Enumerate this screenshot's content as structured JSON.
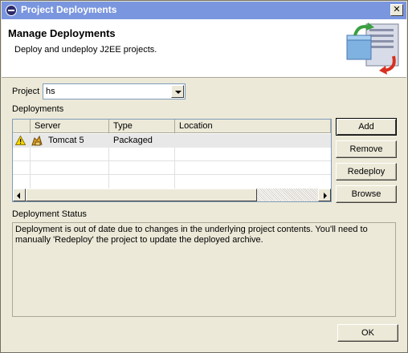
{
  "window": {
    "title": "Project Deployments",
    "close_label": "✕"
  },
  "banner": {
    "title": "Manage Deployments",
    "description": "Deploy and undeploy J2EE projects."
  },
  "project": {
    "label": "Project",
    "selected": "hs"
  },
  "deployments": {
    "label": "Deployments",
    "columns": [
      "",
      "Server",
      "Type",
      "Location"
    ],
    "rows": [
      {
        "status": "warning",
        "server": "Tomcat 5",
        "type": "Packaged",
        "location": ""
      }
    ]
  },
  "buttons": {
    "add": "Add",
    "remove": "Remove",
    "redeploy": "Redeploy",
    "browse": "Browse",
    "ok": "OK"
  },
  "status": {
    "label": "Deployment Status",
    "text": "Deployment is out of date due to changes in the underlying project contents. You'll need to manually 'Redeploy' the project to update the deployed archive."
  },
  "icons": {
    "title": "eclipse-icon",
    "banner": "deployment-wizard-icon",
    "row_status": "warning-icon",
    "server": "tomcat-icon"
  },
  "colors": {
    "titlebar": "#7a96df",
    "banner": "#ffffff",
    "dialog": "#ece9d8",
    "warning": "#f5d800"
  }
}
